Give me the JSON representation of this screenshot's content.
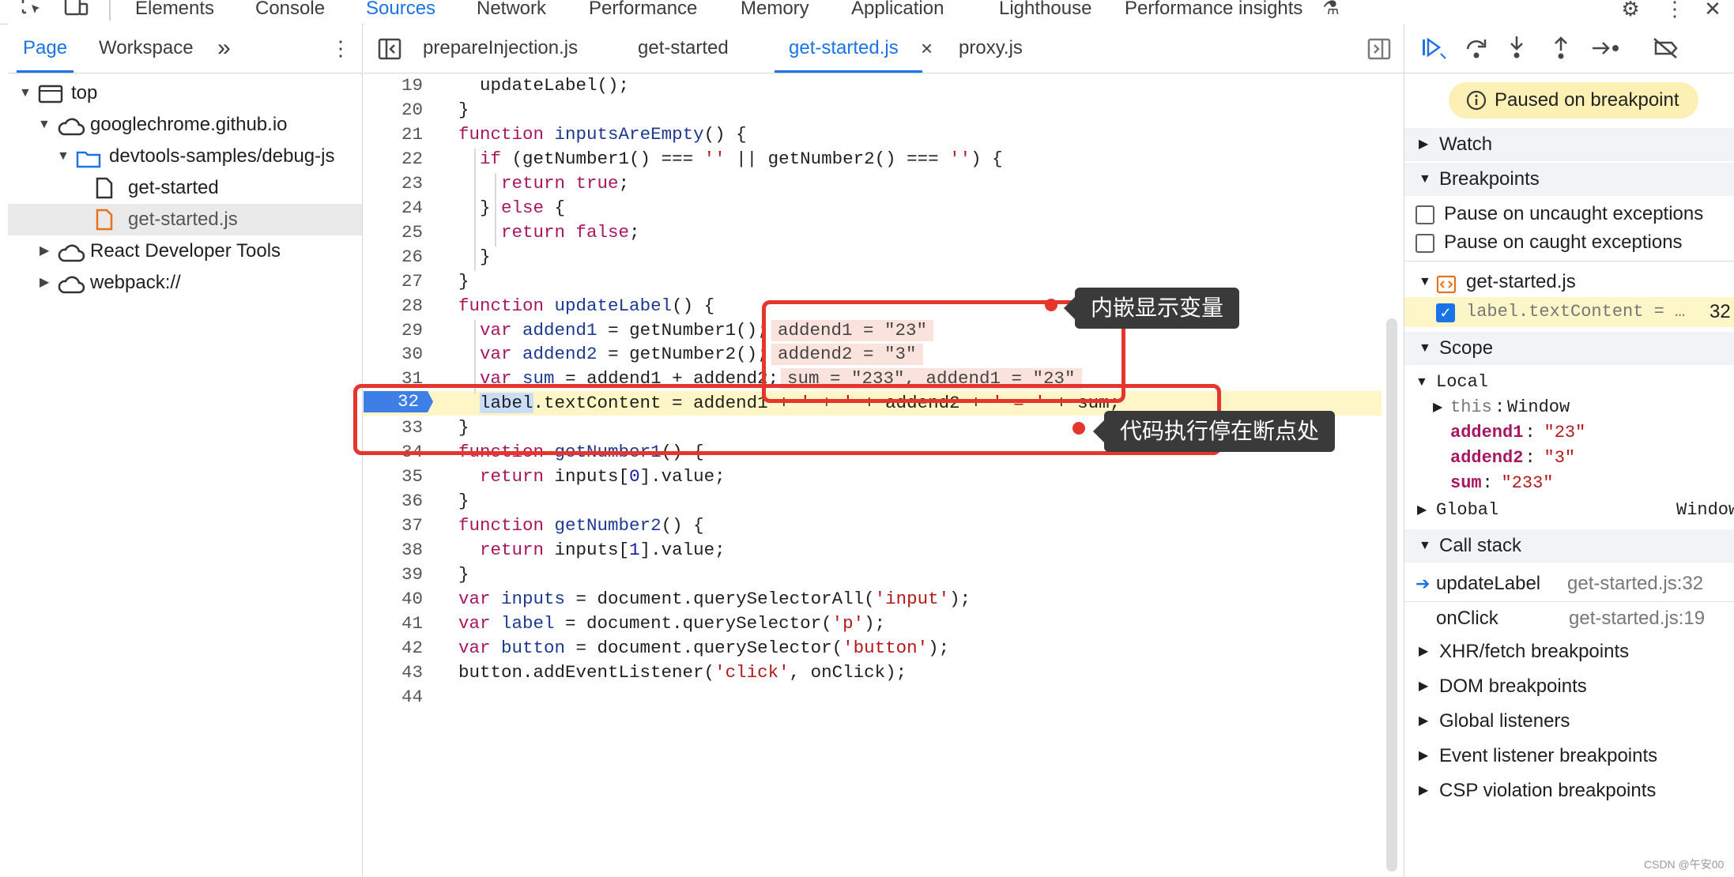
{
  "top_tabs": [
    "Elements",
    "Console",
    "Sources",
    "Network",
    "Performance",
    "Memory",
    "Application",
    "Lighthouse",
    "Performance insights"
  ],
  "active_top_tab": "Sources",
  "navigator": {
    "tabs": [
      "Page",
      "Workspace"
    ],
    "more": "»",
    "tree": [
      "top",
      "googlechrome.github.io",
      "devtools-samples/debug-js",
      "get-started",
      "get-started.js",
      "React Developer Tools",
      "webpack://"
    ]
  },
  "editor": {
    "tabs": [
      "prepareInjection.js",
      "get-started",
      "get-started.js",
      "proxy.js"
    ],
    "active_tab": "get-started.js",
    "close_glyph": "×",
    "current_line": "32",
    "lines": [
      {
        "n": "19",
        "code": "  updateLabel();"
      },
      {
        "n": "20",
        "code": "}"
      },
      {
        "n": "21",
        "code": "function inputsAreEmpty() {"
      },
      {
        "n": "22",
        "code": "  if (getNumber1() === '' || getNumber2() === '') {"
      },
      {
        "n": "23",
        "code": "    return true;"
      },
      {
        "n": "24",
        "code": "  } else {"
      },
      {
        "n": "25",
        "code": "    return false;"
      },
      {
        "n": "26",
        "code": "  }"
      },
      {
        "n": "27",
        "code": "}"
      },
      {
        "n": "28",
        "code": "function updateLabel() {"
      },
      {
        "n": "29",
        "code": "  var addend1 = getNumber1();"
      },
      {
        "n": "30",
        "code": "  var addend2 = getNumber2();"
      },
      {
        "n": "31",
        "code": "  var sum = addend1 + addend2;"
      },
      {
        "n": "32",
        "code": "  label.textContent = addend1 + ' + ' + addend2 + ' = ' + sum;"
      },
      {
        "n": "33",
        "code": "}"
      },
      {
        "n": "34",
        "code": "function getNumber1() {"
      },
      {
        "n": "35",
        "code": "  return inputs[0].value;"
      },
      {
        "n": "36",
        "code": "}"
      },
      {
        "n": "37",
        "code": "function getNumber2() {"
      },
      {
        "n": "38",
        "code": "  return inputs[1].value;"
      },
      {
        "n": "39",
        "code": "}"
      },
      {
        "n": "40",
        "code": "var inputs = document.querySelectorAll('input');"
      },
      {
        "n": "41",
        "code": "var label = document.querySelector('p');"
      },
      {
        "n": "42",
        "code": "var button = document.querySelector('button');"
      },
      {
        "n": "43",
        "code": "button.addEventListener('click', onClick);"
      },
      {
        "n": "44",
        "code": ""
      }
    ],
    "inline_values": {
      "line29": "addend1 = \"23\"",
      "line30": "addend2 = \"3\"",
      "line31": "sum = \"233\", addend1 = \"23\""
    }
  },
  "debugger": {
    "paused_text": "Paused on breakpoint",
    "sections": {
      "watch": "Watch",
      "breakpoints": "Breakpoints",
      "scope": "Scope",
      "call_stack": "Call stack",
      "xhr": "XHR/fetch breakpoints",
      "dom": "DOM breakpoints",
      "global_listeners": "Global listeners",
      "event_listener": "Event listener breakpoints",
      "csp": "CSP violation breakpoints"
    },
    "pause_uncaught": "Pause on uncaught exceptions",
    "pause_caught": "Pause on caught exceptions",
    "bp_file": "get-started.js",
    "bp_code": "label.textContent = …",
    "bp_line": "32",
    "scope": {
      "local": "Local",
      "this_key": "this",
      "this_val": "Window",
      "vars": [
        {
          "k": "addend1",
          "v": "\"23\""
        },
        {
          "k": "addend2",
          "v": "\"3\""
        },
        {
          "k": "sum",
          "v": "\"233\""
        }
      ],
      "global": "Global",
      "global_val": "Window"
    },
    "call_stack": [
      {
        "fn": "updateLabel",
        "loc": "get-started.js:32"
      },
      {
        "fn": "onClick",
        "loc": "get-started.js:19"
      }
    ]
  },
  "annotations": {
    "inline_vars": "内嵌显示变量",
    "paused_here": "代码执行停在断点处"
  },
  "watermark": "CSDN @午安00",
  "colors": {
    "accent": "#1a73e8",
    "annotation_red": "#e5352c",
    "breakpoint_blue": "#3d7fe6",
    "paused_line": "#fef6c6"
  }
}
